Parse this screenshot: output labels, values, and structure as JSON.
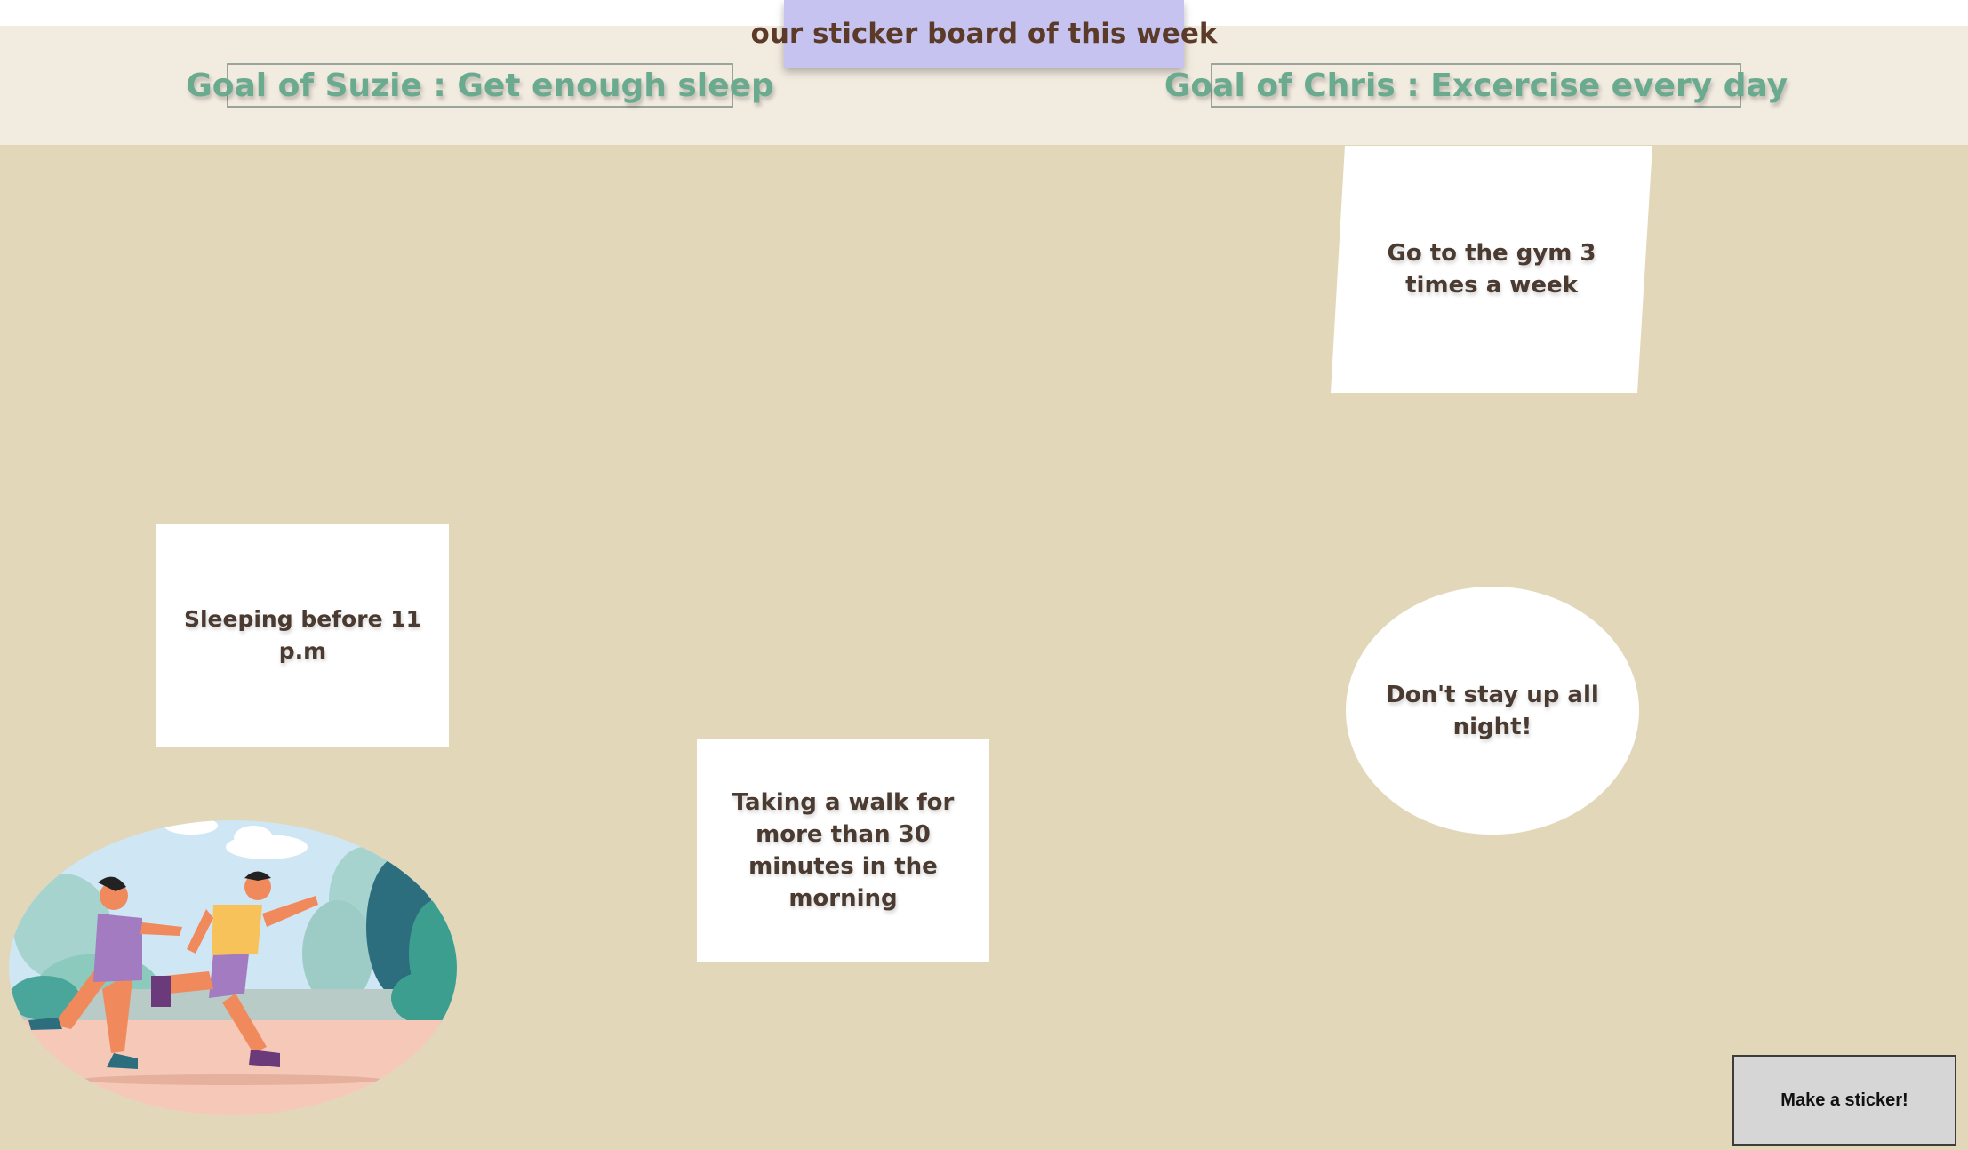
{
  "board": {
    "title": "our sticker board of this week"
  },
  "goals": {
    "suzie": "Goal of Suzie : Get enough sleep",
    "chris": "Goal of Chris : Excercise every day"
  },
  "stickers": [
    {
      "text": "Go to the gym 3 times a week",
      "shape": "skewed-square"
    },
    {
      "text": "Sleeping before 11 p.m",
      "shape": "square"
    },
    {
      "text": "Taking a walk for more than 30 minutes in the morning",
      "shape": "square"
    },
    {
      "text": "Don't stay up all night!",
      "shape": "oval"
    }
  ],
  "illustration": {
    "subject": "two people jogging in a park"
  },
  "actions": {
    "make_sticker_label": "Make a sticker!"
  },
  "colors": {
    "board_background": "#e2d7b8",
    "header_background": "#f2ebe0",
    "title_background": "#c6c3f0",
    "goal_text": "#6aaa8e",
    "sticker_background": "#ffffff"
  }
}
